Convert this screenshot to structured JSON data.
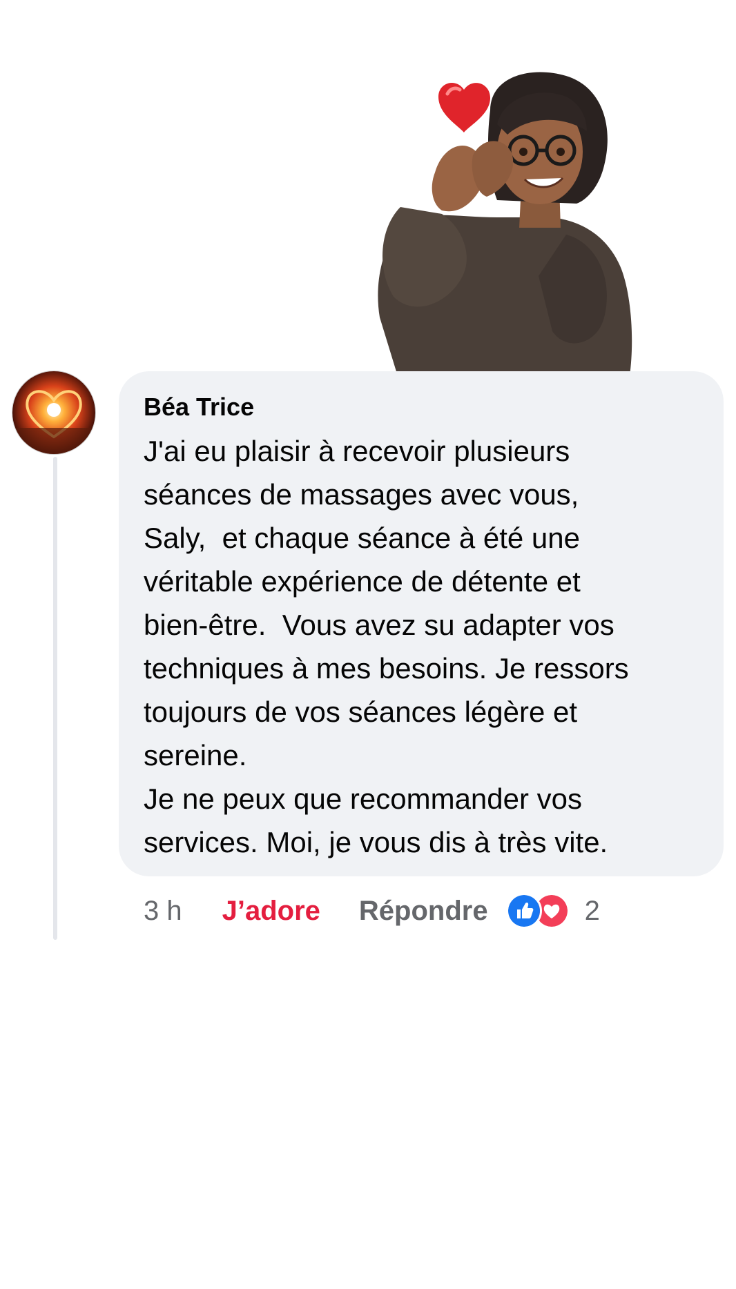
{
  "comment": {
    "author": "Béa Trice",
    "lines": [
      "J'ai eu plaisir à recevoir plusieurs",
      "séances de massages avec vous,",
      "Saly,  et chaque séance à été une",
      "véritable expérience de détente et",
      "bien-être.  Vous avez su adapter vos",
      "techniques à mes besoins. Je ressors",
      "toujours de vos séances légère et",
      "sereine.",
      "Je ne peux que recommander vos",
      "services. Moi, je vous dis à très vite."
    ],
    "time": "3 h",
    "love_label": "J’adore",
    "reply_label": "Répondre",
    "reaction_count": "2",
    "reaction_icons": [
      "like-icon",
      "love-icon"
    ]
  },
  "colors": {
    "bubble_background": "#f0f2f5",
    "love_red": "#e41e3f",
    "like_blue": "#1877f2",
    "meta_gray": "#65676b"
  }
}
